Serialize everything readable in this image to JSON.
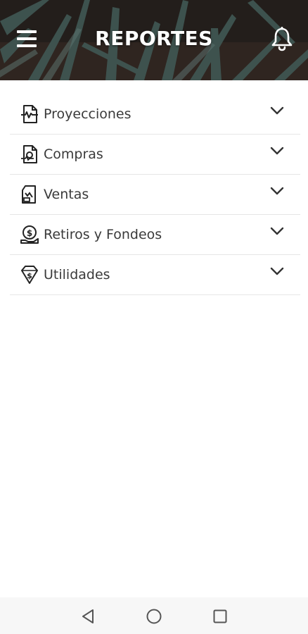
{
  "header": {
    "title": "REPORTES",
    "menu_icon": "hamburger-menu-icon",
    "notification_icon": "bell-icon"
  },
  "reports": {
    "items": [
      {
        "label": "Proyecciones",
        "icon": "chart-document-icon"
      },
      {
        "label": "Compras",
        "icon": "purchase-document-icon"
      },
      {
        "label": "Ventas",
        "icon": "sales-document-icon"
      },
      {
        "label": "Retiros y Fondeos",
        "icon": "coin-hand-icon"
      },
      {
        "label": "Utilidades",
        "icon": "diamond-dollar-icon"
      }
    ],
    "expand_icon": "chevron-down-icon"
  },
  "system_nav": {
    "back_icon": "back-triangle-icon",
    "home_icon": "home-circle-icon",
    "recents_icon": "recents-square-icon"
  },
  "colors": {
    "header_bg": "#2a2420",
    "title_text": "#ffffff",
    "item_text": "#3a3a3a",
    "divider": "#e6e6e6",
    "nav_bar": "#f7f7f7"
  }
}
